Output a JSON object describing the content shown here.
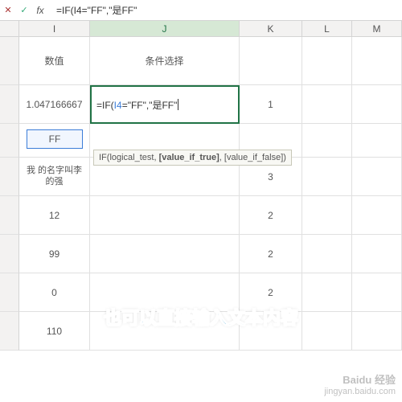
{
  "formula_bar": {
    "text": "=IF(I4=\"FF\",\"是FF\""
  },
  "columns": [
    "I",
    "J",
    "K",
    "L",
    "M"
  ],
  "active_column": "J",
  "headers": {
    "I": "数值",
    "J": "条件选择"
  },
  "cells": {
    "I3": "1.047166667",
    "K3": "1",
    "I4": "FF",
    "I5": "我    的名字叫李的强",
    "K5": "3",
    "I6": "12",
    "K6": "2",
    "I7": "99",
    "K7": "2",
    "I8": "0",
    "K8": "2",
    "I9": "110"
  },
  "active_cell": {
    "ref_prefix": "=IF(",
    "ref": "I4",
    "ref_suffix": "=\"FF\",\"是FF\""
  },
  "tooltip": {
    "fn": "IF(logical_test, ",
    "bold": "[value_if_true]",
    "rest": ", [value_if_false])"
  },
  "caption": "也可以直接输入文本内容",
  "watermark": {
    "line1": "Baidu 经验",
    "line2": "jingyan.baidu.com"
  }
}
